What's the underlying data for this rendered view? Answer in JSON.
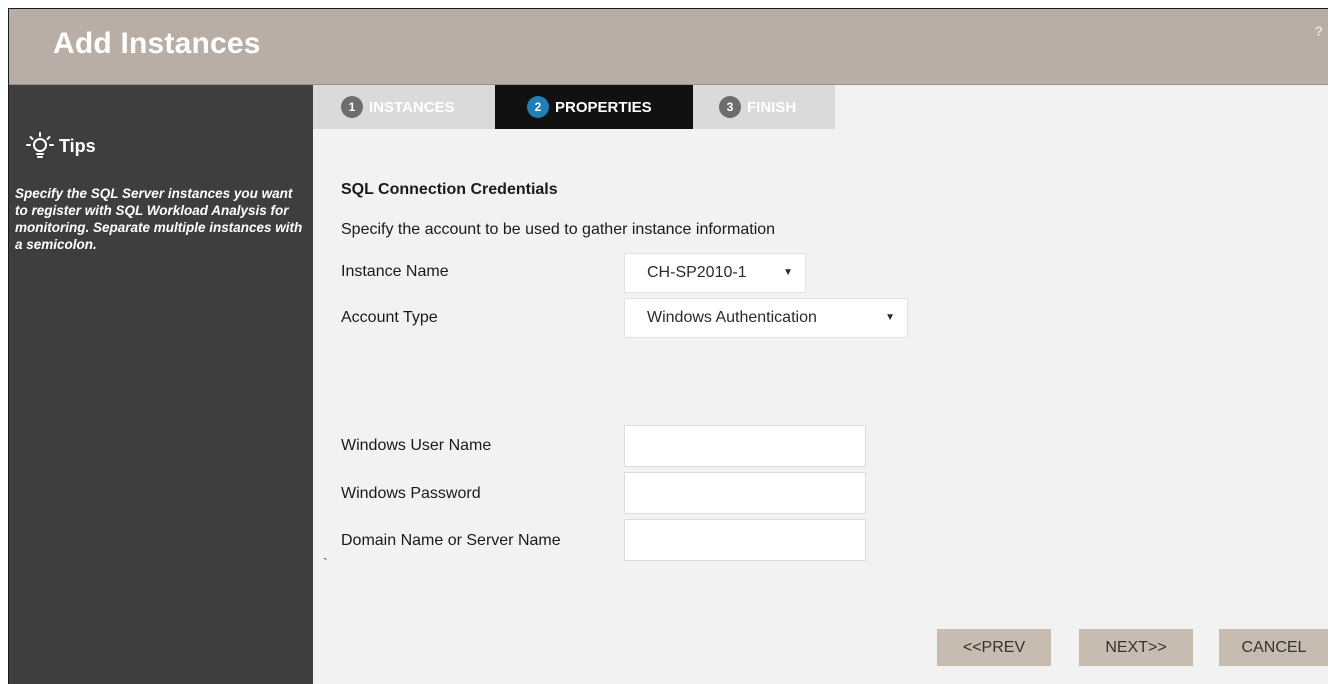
{
  "window": {
    "title": "Add Instances",
    "help_label": "?"
  },
  "tips": {
    "heading": "Tips",
    "text": "Specify the SQL Server instances you want to register with SQL Workload Analysis for monitoring. Separate multiple instances with a semicolon."
  },
  "tabs": [
    {
      "number": "1",
      "label": "INSTANCES",
      "active": false
    },
    {
      "number": "2",
      "label": "PROPERTIES",
      "active": true
    },
    {
      "number": "3",
      "label": "FINISH",
      "active": false
    }
  ],
  "form": {
    "section_title": "SQL Connection Credentials",
    "description": "Specify the account to be used to gather instance information",
    "instance_name": {
      "label": "Instance Name",
      "value": "CH-SP2010-1"
    },
    "account_type": {
      "label": "Account Type",
      "value": "Windows Authentication"
    },
    "windows_user_name": {
      "label": "Windows User Name",
      "value": ""
    },
    "windows_password": {
      "label": "Windows Password",
      "value": ""
    },
    "domain_name": {
      "label": "Domain Name or Server Name",
      "value": ""
    },
    "stray_mark": "`"
  },
  "buttons": {
    "prev": "<<PREV",
    "next": "NEXT>>",
    "cancel": "CANCEL"
  },
  "colors": {
    "titlebar": "#b9aea5",
    "sidebar": "#3e3e3e",
    "active_tab": "#111111",
    "active_tab_number": "#1f7fb6",
    "inactive_tab": "#dadada",
    "button": "#c8bcb0"
  },
  "icons": {
    "tips": "lightbulb-icon",
    "dropdown": "caret-down-icon"
  }
}
